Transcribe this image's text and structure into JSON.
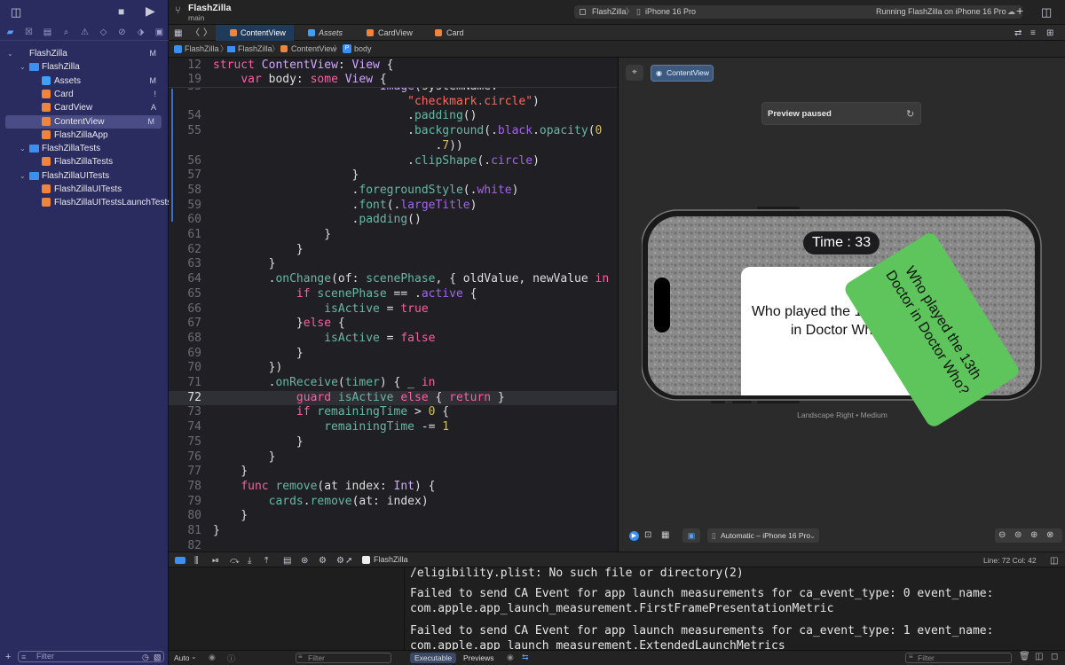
{
  "toolbar": {
    "project_name": "FlashZilla",
    "branch": "main",
    "scheme": "FlashZilla",
    "device": "iPhone 16 Pro",
    "status": "Running FlashZilla on iPhone 16 Pro"
  },
  "tabs": [
    {
      "label": "ContentView"
    },
    {
      "label": "Assets"
    },
    {
      "label": "CardView"
    },
    {
      "label": "Card"
    }
  ],
  "jumpbar": [
    "FlashZilla",
    "FlashZilla",
    "ContentView",
    "body"
  ],
  "navigator": [
    {
      "label": "FlashZilla",
      "badge": "M",
      "type": "project"
    },
    {
      "label": "FlashZilla",
      "badge": "",
      "type": "folder"
    },
    {
      "label": "Assets",
      "badge": "M",
      "type": "asset"
    },
    {
      "label": "Card",
      "badge": "!",
      "type": "swift"
    },
    {
      "label": "CardView",
      "badge": "A",
      "type": "swift"
    },
    {
      "label": "ContentView",
      "badge": "M",
      "type": "swift"
    },
    {
      "label": "FlashZillaApp",
      "badge": "",
      "type": "swift"
    },
    {
      "label": "FlashZillaTests",
      "badge": "",
      "type": "folder"
    },
    {
      "label": "FlashZillaTests",
      "badge": "",
      "type": "swift"
    },
    {
      "label": "FlashZillaUITests",
      "badge": "",
      "type": "folder"
    },
    {
      "label": "FlashZillaUITests",
      "badge": "",
      "type": "swift"
    },
    {
      "label": "FlashZillaUITestsLaunchTests",
      "badge": "",
      "type": "swift"
    }
  ],
  "filter_placeholder": "Filter",
  "code": {
    "sticky": [
      {
        "ln": "12",
        "text": "struct ContentView: View {"
      },
      {
        "ln": "19",
        "text": "    var body: some View {"
      }
    ],
    "lines": [
      {
        "ln": "53",
        "text": "                        Image(systemName:"
      },
      {
        "ln": "",
        "text": "                            \"checkmark.circle\")"
      },
      {
        "ln": "54",
        "text": "                            .padding()"
      },
      {
        "ln": "55",
        "text": "                            .background(.black.opacity(0"
      },
      {
        "ln": "",
        "text": "                                .7))"
      },
      {
        "ln": "56",
        "text": "                            .clipShape(.circle)"
      },
      {
        "ln": "57",
        "text": "                    }"
      },
      {
        "ln": "58",
        "text": "                    .foregroundStyle(.white)"
      },
      {
        "ln": "59",
        "text": "                    .font(.largeTitle)"
      },
      {
        "ln": "60",
        "text": "                    .padding()"
      },
      {
        "ln": "61",
        "text": "                }"
      },
      {
        "ln": "62",
        "text": "            }"
      },
      {
        "ln": "63",
        "text": "        }"
      },
      {
        "ln": "64",
        "text": "        .onChange(of: scenePhase, { oldValue, newValue in"
      },
      {
        "ln": "65",
        "text": "            if scenePhase == .active {"
      },
      {
        "ln": "66",
        "text": "                isActive = true"
      },
      {
        "ln": "67",
        "text": "            }else {"
      },
      {
        "ln": "68",
        "text": "                isActive = false"
      },
      {
        "ln": "69",
        "text": "            }"
      },
      {
        "ln": "70",
        "text": "        })"
      },
      {
        "ln": "71",
        "text": "        .onReceive(timer) { _ in"
      },
      {
        "ln": "72",
        "text": "            guard isActive else { return }"
      },
      {
        "ln": "73",
        "text": "            if remainingTime > 0 {"
      },
      {
        "ln": "74",
        "text": "                remainingTime -= 1"
      },
      {
        "ln": "75",
        "text": "            }"
      },
      {
        "ln": "76",
        "text": "        }"
      },
      {
        "ln": "77",
        "text": "    }"
      },
      {
        "ln": "78",
        "text": "    func remove(at index: Int) {"
      },
      {
        "ln": "79",
        "text": "        cards.remove(at: index)"
      },
      {
        "ln": "80",
        "text": "    }"
      },
      {
        "ln": "81",
        "text": "}"
      },
      {
        "ln": "82",
        "text": ""
      }
    ],
    "current_line": "72"
  },
  "preview": {
    "chip": "ContentView",
    "status": "Preview paused",
    "timer": "Time : 33",
    "card_text": "Who played the 13th Doctor in Doctor Who?",
    "green_card_text": "Who played the 13th Doctor in Doctor Who?",
    "orientation": "Landscape Right • Medium",
    "device_selector": "Automatic – iPhone 16 Pro",
    "green": "#5dc55b"
  },
  "debug": {
    "target": "FlashZilla",
    "position": "Line: 72  Col: 42",
    "auto": "Auto",
    "filter": "Filter",
    "tab_executable": "Executable",
    "tab_previews": "Previews"
  },
  "console": [
    "/eligibility.plist: No such file or directory(2)",
    "Failed to send CA Event for app launch measurements for ca_event_type: 0 event_name:",
    "com.apple.app_launch_measurement.FirstFramePresentationMetric",
    "",
    "Failed to send CA Event for app launch measurements for ca_event_type: 1 event_name:",
    "com.apple.app_launch_measurement.ExtendedLaunchMetrics"
  ]
}
